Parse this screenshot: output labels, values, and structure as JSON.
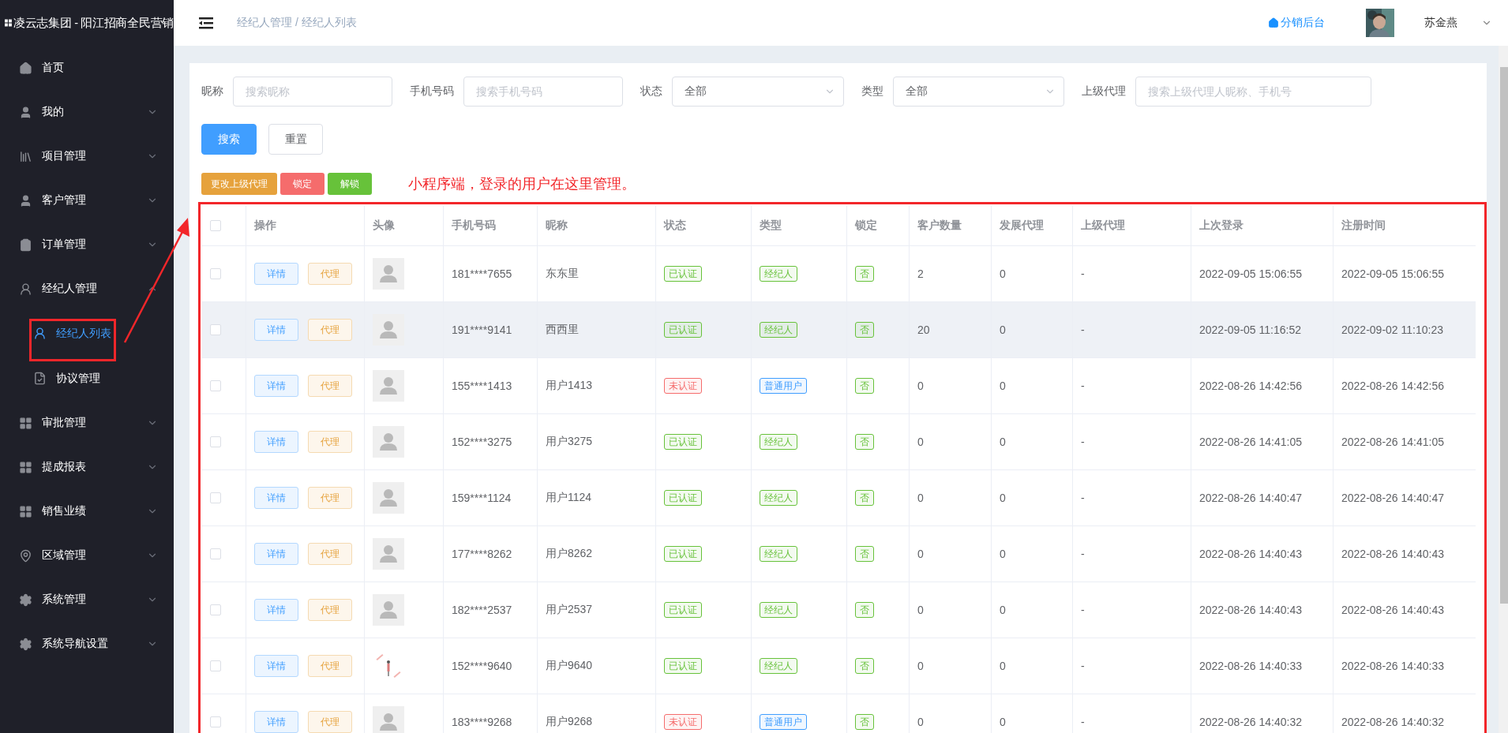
{
  "brand": {
    "title": "凌云志集团 - 阳江招商全民营销"
  },
  "sidebar": {
    "items": [
      {
        "label": "首页"
      },
      {
        "label": "我的",
        "expanded": false
      },
      {
        "label": "项目管理",
        "expanded": false
      },
      {
        "label": "客户管理",
        "expanded": false
      },
      {
        "label": "订单管理",
        "expanded": false
      },
      {
        "label": "经纪人管理",
        "expanded": true,
        "children": [
          {
            "label": "经纪人列表",
            "selected": true
          },
          {
            "label": "协议管理",
            "selected": false
          }
        ]
      },
      {
        "label": "审批管理",
        "expanded": false
      },
      {
        "label": "提成报表",
        "expanded": false
      },
      {
        "label": "销售业绩",
        "expanded": false
      },
      {
        "label": "区域管理",
        "expanded": false
      },
      {
        "label": "系统管理",
        "expanded": false
      },
      {
        "label": "系统导航设置",
        "expanded": false
      }
    ]
  },
  "header": {
    "breadcrumb": "经纪人管理 / 经纪人列表",
    "link": "分销后台",
    "user": "苏金燕"
  },
  "filters": [
    {
      "kind": "input",
      "label": "昵称",
      "placeholder": "搜索昵称"
    },
    {
      "kind": "input",
      "label": "手机号码",
      "placeholder": "搜索手机号码"
    },
    {
      "kind": "select",
      "label": "状态",
      "value": "全部"
    },
    {
      "kind": "select",
      "label": "类型",
      "value": "全部"
    },
    {
      "kind": "input",
      "label": "上级代理",
      "placeholder": "搜索上级代理人昵称、手机号"
    }
  ],
  "form_buttons": [
    {
      "label": "搜索",
      "kind": "primary"
    },
    {
      "label": "重置",
      "kind": "plain"
    }
  ],
  "batch_buttons": [
    {
      "label": "更改上级代理",
      "color": "#e6a23c"
    },
    {
      "label": "锁定",
      "color": "#f56c6c"
    },
    {
      "label": "解锁",
      "color": "#67c23a"
    }
  ],
  "annotation": "小程序端，登录的用户在这里管理。",
  "table": {
    "select_all_checked": false,
    "columns": [
      "操作",
      "头像",
      "手机号码",
      "昵称",
      "状态",
      "类型",
      "锁定",
      "客户数量",
      "发展代理",
      "上级代理",
      "上次登录",
      "注册时间"
    ],
    "rows": [
      {
        "checked": false,
        "highlighted": false,
        "detail": "详情",
        "agent": "代理",
        "avatar": {
          "kind": "default"
        },
        "phone": "181****7655",
        "nickname": "东东里",
        "status": {
          "text": "已认证",
          "color": "#67c23a"
        },
        "type": {
          "text": "经纪人",
          "color": "#67c23a"
        },
        "locked": {
          "text": "否",
          "color": "#67c23a"
        },
        "customers": "2",
        "agents": "0",
        "parent": "-",
        "last_login": "2022-09-05 15:06:55",
        "registered": "2022-09-05 15:06:55"
      },
      {
        "checked": false,
        "highlighted": true,
        "detail": "详情",
        "agent": "代理",
        "avatar": {
          "kind": "default"
        },
        "phone": "191****9141",
        "nickname": "西西里",
        "status": {
          "text": "已认证",
          "color": "#67c23a"
        },
        "type": {
          "text": "经纪人",
          "color": "#67c23a"
        },
        "locked": {
          "text": "否",
          "color": "#67c23a"
        },
        "customers": "20",
        "agents": "0",
        "parent": "-",
        "last_login": "2022-09-05 11:16:52",
        "registered": "2022-09-02 11:10:23"
      },
      {
        "checked": false,
        "highlighted": false,
        "detail": "详情",
        "agent": "代理",
        "avatar": {
          "kind": "default"
        },
        "phone": "155****1413",
        "nickname": "用户1413",
        "status": {
          "text": "未认证",
          "color": "#f56c6c"
        },
        "type": {
          "text": "普通用户",
          "color": "#409eff"
        },
        "locked": {
          "text": "否",
          "color": "#67c23a"
        },
        "customers": "0",
        "agents": "0",
        "parent": "-",
        "last_login": "2022-08-26 14:42:56",
        "registered": "2022-08-26 14:42:56"
      },
      {
        "checked": false,
        "highlighted": false,
        "detail": "详情",
        "agent": "代理",
        "avatar": {
          "kind": "default"
        },
        "phone": "152****3275",
        "nickname": "用户3275",
        "status": {
          "text": "已认证",
          "color": "#67c23a"
        },
        "type": {
          "text": "经纪人",
          "color": "#67c23a"
        },
        "locked": {
          "text": "否",
          "color": "#67c23a"
        },
        "customers": "0",
        "agents": "0",
        "parent": "-",
        "last_login": "2022-08-26 14:41:05",
        "registered": "2022-08-26 14:41:05"
      },
      {
        "checked": false,
        "highlighted": false,
        "detail": "详情",
        "agent": "代理",
        "avatar": {
          "kind": "default"
        },
        "phone": "159****1124",
        "nickname": "用户1124",
        "status": {
          "text": "已认证",
          "color": "#67c23a"
        },
        "type": {
          "text": "经纪人",
          "color": "#67c23a"
        },
        "locked": {
          "text": "否",
          "color": "#67c23a"
        },
        "customers": "0",
        "agents": "0",
        "parent": "-",
        "last_login": "2022-08-26 14:40:47",
        "registered": "2022-08-26 14:40:47"
      },
      {
        "checked": false,
        "highlighted": false,
        "detail": "详情",
        "agent": "代理",
        "avatar": {
          "kind": "default"
        },
        "phone": "177****8262",
        "nickname": "用户8262",
        "status": {
          "text": "已认证",
          "color": "#67c23a"
        },
        "type": {
          "text": "经纪人",
          "color": "#67c23a"
        },
        "locked": {
          "text": "否",
          "color": "#67c23a"
        },
        "customers": "0",
        "agents": "0",
        "parent": "-",
        "last_login": "2022-08-26 14:40:43",
        "registered": "2022-08-26 14:40:43"
      },
      {
        "checked": false,
        "highlighted": false,
        "detail": "详情",
        "agent": "代理",
        "avatar": {
          "kind": "default"
        },
        "phone": "182****2537",
        "nickname": "用户2537",
        "status": {
          "text": "已认证",
          "color": "#67c23a"
        },
        "type": {
          "text": "经纪人",
          "color": "#67c23a"
        },
        "locked": {
          "text": "否",
          "color": "#67c23a"
        },
        "customers": "0",
        "agents": "0",
        "parent": "-",
        "last_login": "2022-08-26 14:40:43",
        "registered": "2022-08-26 14:40:43"
      },
      {
        "checked": false,
        "highlighted": false,
        "detail": "详情",
        "agent": "代理",
        "phone": "152****9640",
        "nickname": "用户9640",
        "status": {
          "text": "已认证",
          "color": "#67c23a"
        },
        "type": {
          "text": "经纪人",
          "color": "#67c23a"
        },
        "locked": {
          "text": "否",
          "color": "#67c23a"
        },
        "customers": "0",
        "agents": "0",
        "parent": "-",
        "last_login": "2022-08-26 14:40:33",
        "registered": "2022-08-26 14:40:33"
      },
      {
        "checked": false,
        "highlighted": false,
        "detail": "详情",
        "agent": "代理",
        "avatar": {
          "kind": "default"
        },
        "phone": "183****9268",
        "nickname": "用户9268",
        "status": {
          "text": "未认证",
          "color": "#f56c6c"
        },
        "type": {
          "text": "普通用户",
          "color": "#409eff"
        },
        "locked": {
          "text": "否",
          "color": "#67c23a"
        },
        "customers": "0",
        "agents": "0",
        "parent": "-",
        "last_login": "2022-08-26 14:40:32",
        "registered": "2022-08-26 14:40:32"
      }
    ]
  }
}
